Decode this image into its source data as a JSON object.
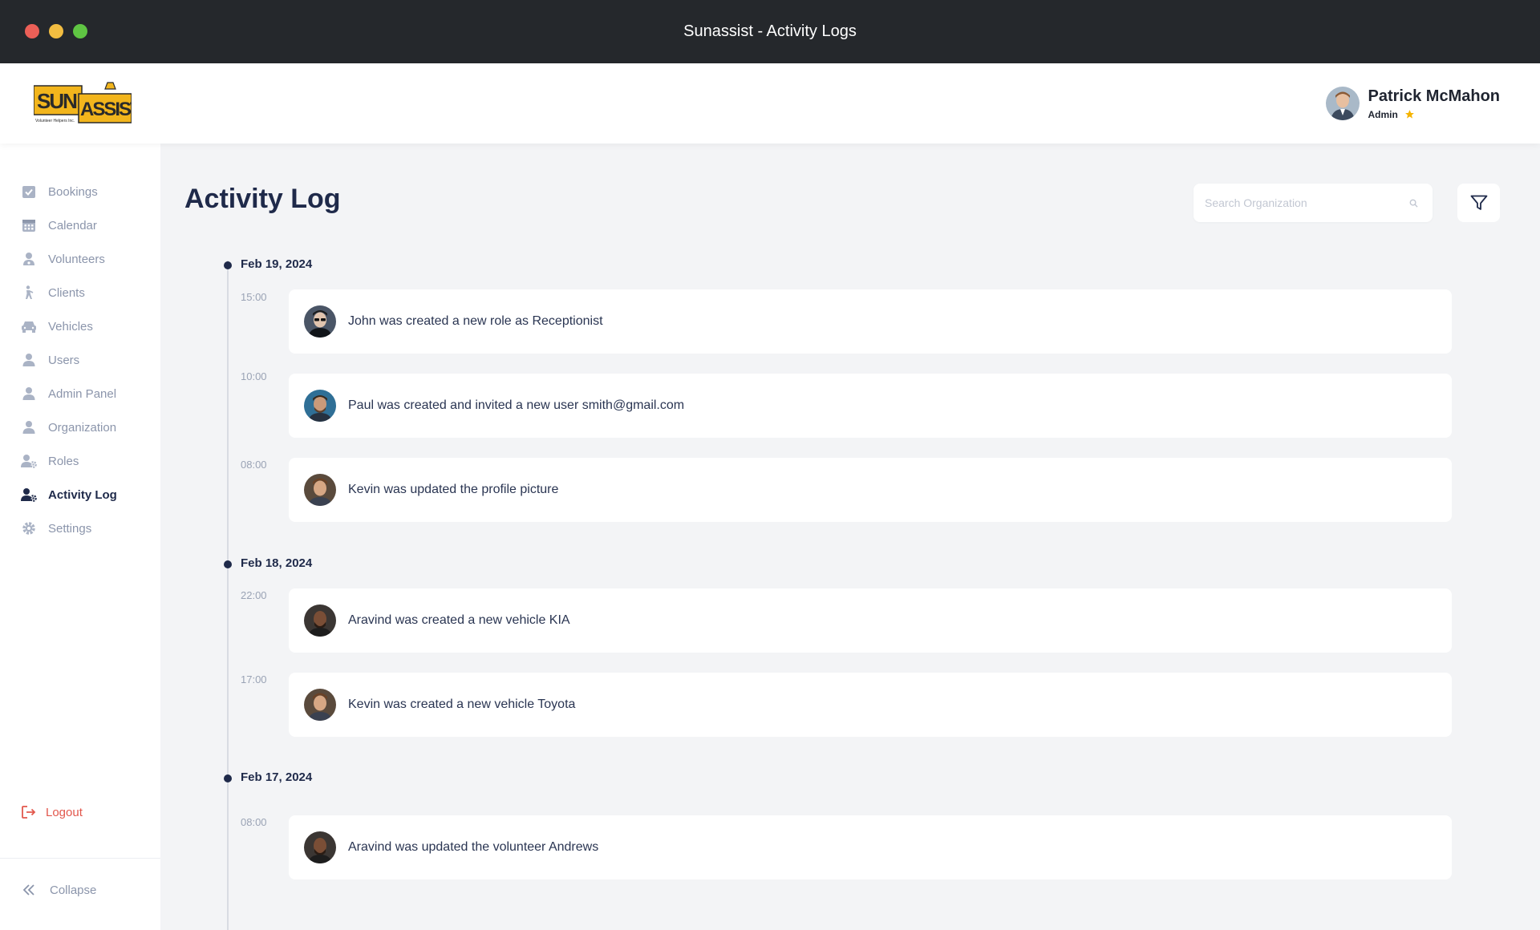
{
  "window": {
    "title": "Sunassist - Activity Logs"
  },
  "header": {
    "logo_text": "SUNASSIST",
    "logo_subtext": "Volunteer Helpers Inc.",
    "user": {
      "name": "Patrick McMahon",
      "role": "Admin"
    }
  },
  "sidebar": {
    "items": [
      {
        "label": "Bookings",
        "icon": "check-calendar-icon"
      },
      {
        "label": "Calendar",
        "icon": "calendar-grid-icon"
      },
      {
        "label": "Volunteers",
        "icon": "volunteer-icon"
      },
      {
        "label": "Clients",
        "icon": "person-walking-icon"
      },
      {
        "label": "Vehicles",
        "icon": "car-icon"
      },
      {
        "label": "Users",
        "icon": "user-icon"
      },
      {
        "label": "Admin Panel",
        "icon": "user-icon"
      },
      {
        "label": "Organization",
        "icon": "user-icon"
      },
      {
        "label": "Roles",
        "icon": "user-gear-icon"
      },
      {
        "label": "Activity Log",
        "icon": "user-gear-icon",
        "active": true
      },
      {
        "label": "Settings",
        "icon": "gear-icon"
      }
    ],
    "logout_label": "Logout",
    "collapse_label": "Collapse"
  },
  "main": {
    "title": "Activity Log",
    "search": {
      "placeholder": "Search Organization",
      "value": ""
    },
    "groups": [
      {
        "date": "Feb 19, 2024",
        "entries": [
          {
            "time": "15:00",
            "message": "John was created a new role as Receptionist"
          },
          {
            "time": "10:00",
            "message": "Paul was created and invited a new user smith@gmail.com"
          },
          {
            "time": "08:00",
            "message": "Kevin was updated the profile picture"
          }
        ]
      },
      {
        "date": "Feb 18, 2024",
        "entries": [
          {
            "time": "22:00",
            "message": "Aravind was created a new vehicle KIA"
          },
          {
            "time": "17:00",
            "message": "Kevin was created a new vehicle Toyota"
          }
        ]
      },
      {
        "date": "Feb 17, 2024",
        "entries": [
          {
            "time": "08:00",
            "message": "Aravind was updated the volunteer Andrews"
          }
        ]
      }
    ]
  },
  "colors": {
    "primary": "#1f2a4a",
    "muted": "#8b95ab",
    "logout": "#e2574c",
    "star": "#f5b400",
    "titlebar": "#25282c"
  }
}
